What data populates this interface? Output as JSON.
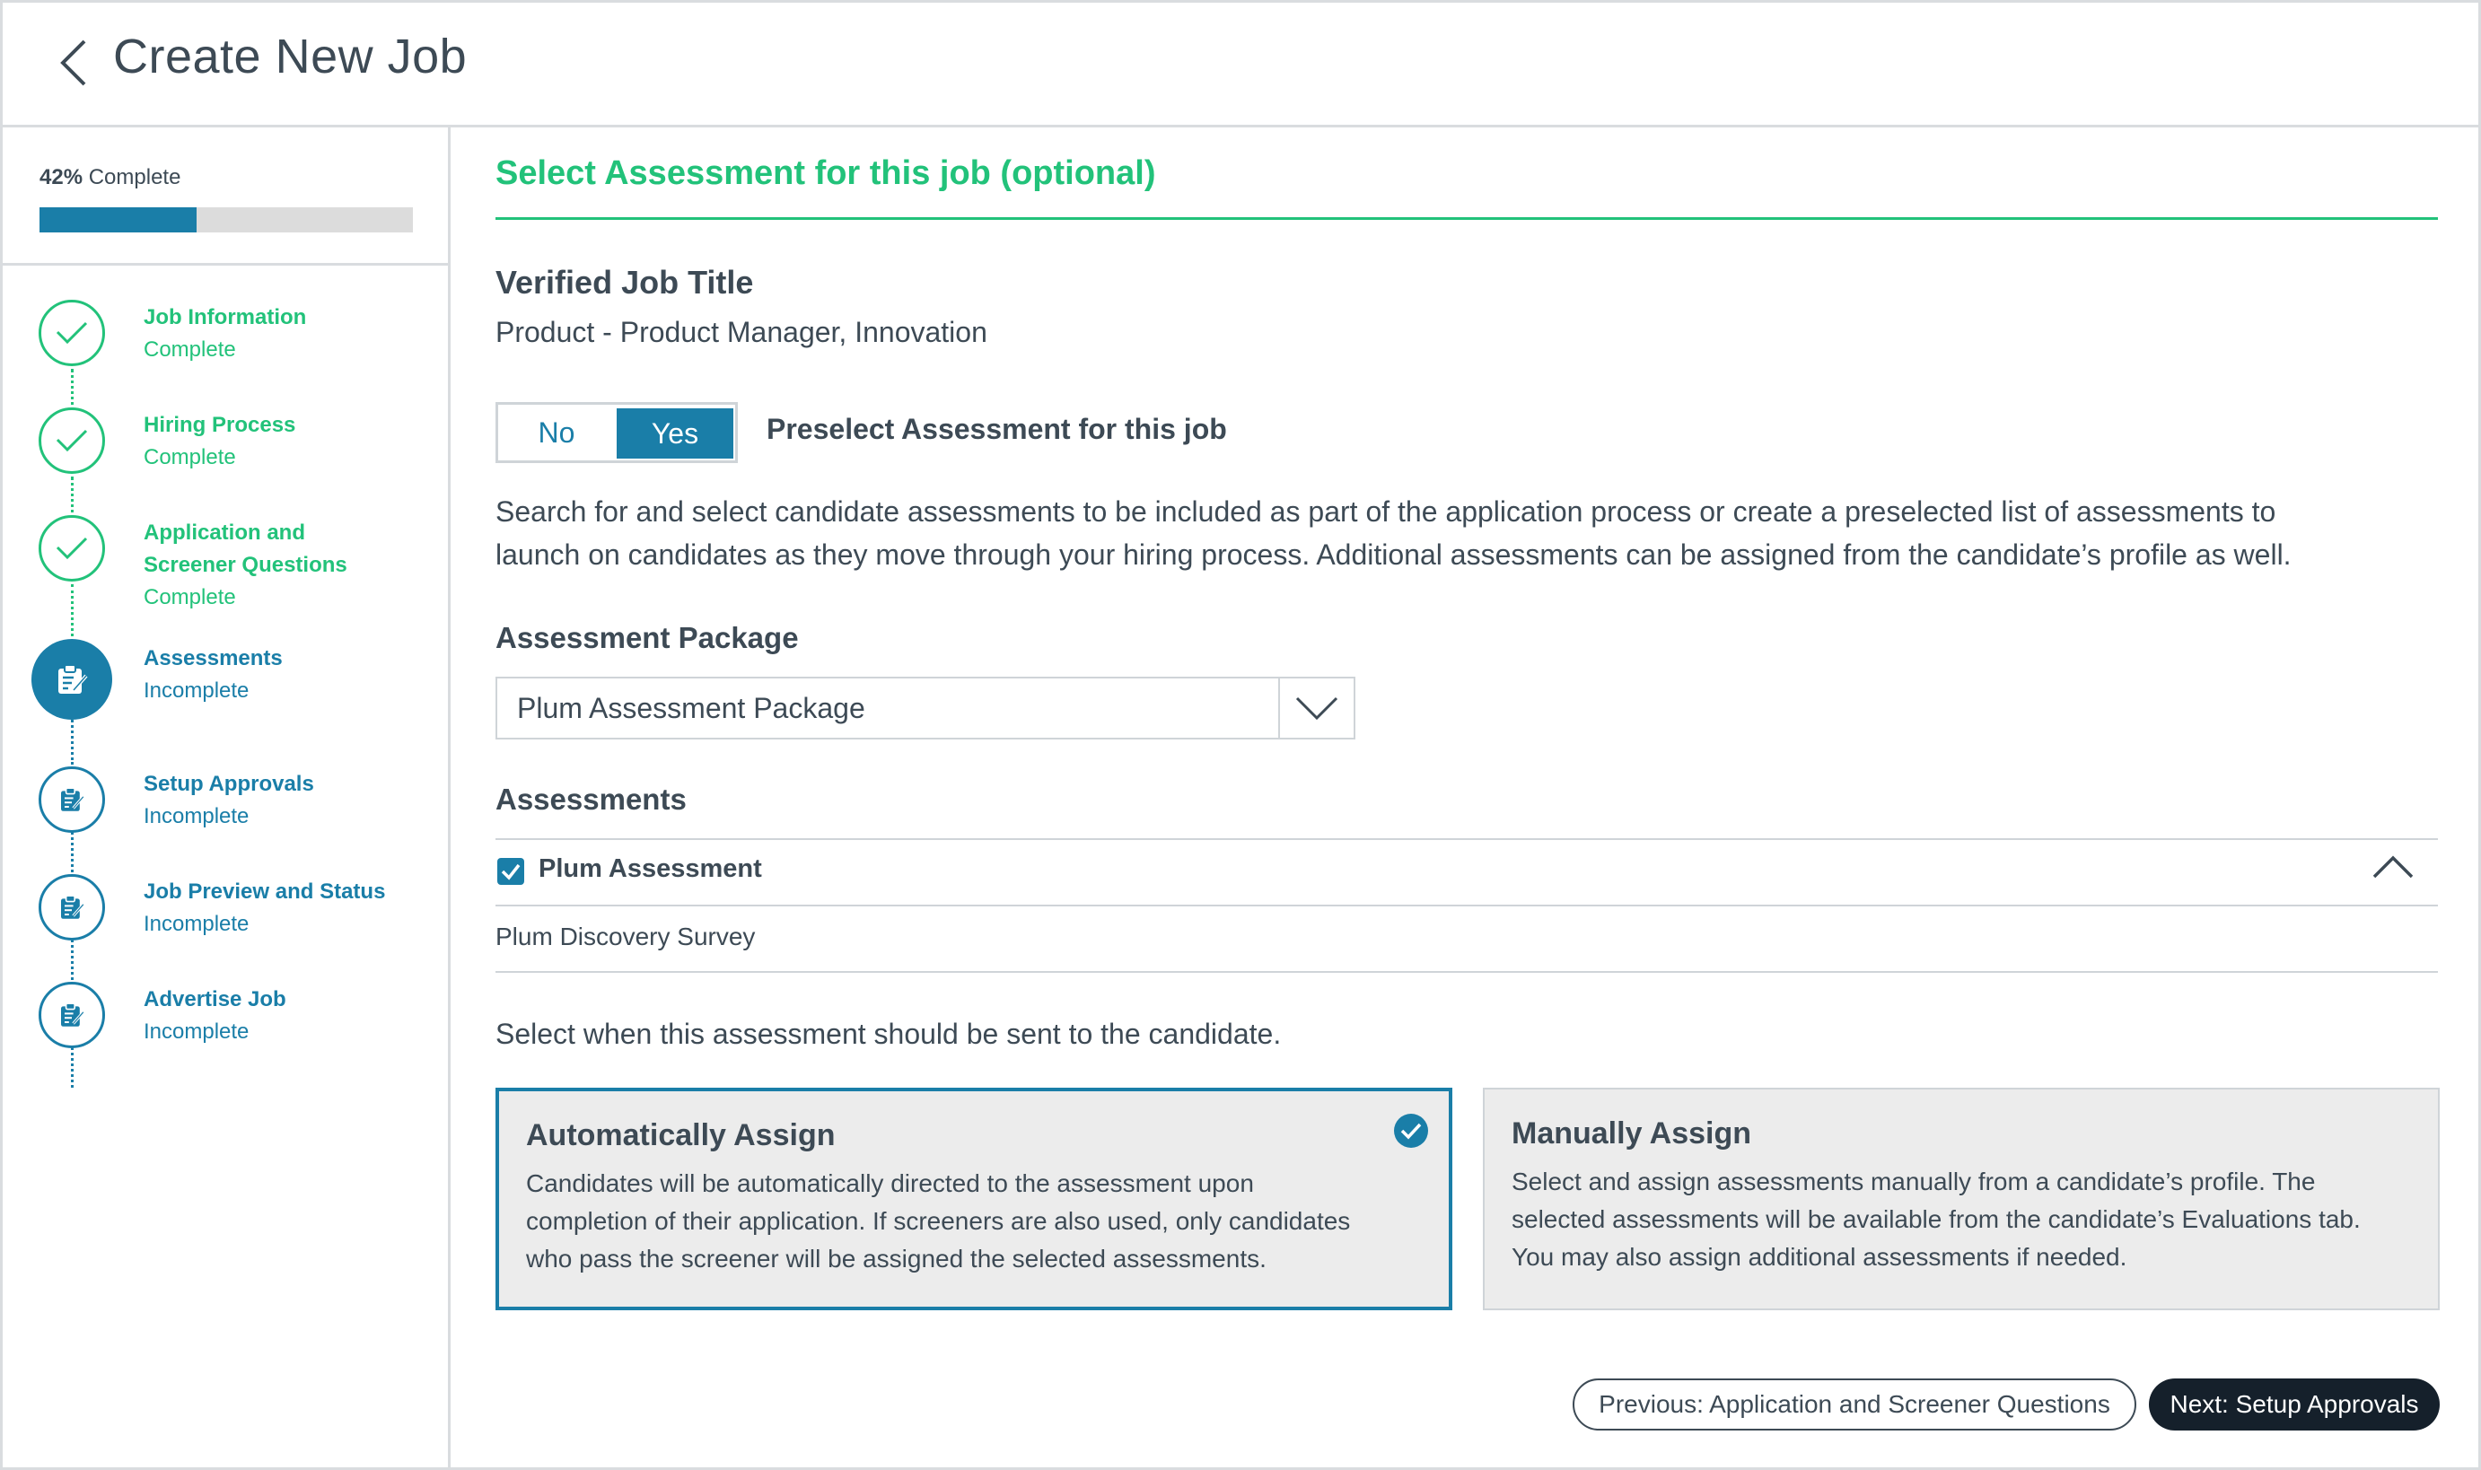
{
  "header": {
    "title": "Create New Job"
  },
  "progress": {
    "percent_label": "42%",
    "suffix": "Complete",
    "fraction": 0.42
  },
  "steps": [
    {
      "title": "Job Information",
      "status": "Complete",
      "state": "complete"
    },
    {
      "title": "Hiring Process",
      "status": "Complete",
      "state": "complete"
    },
    {
      "title_line1": "Application and",
      "title_line2": "Screener Questions",
      "status": "Complete",
      "state": "complete"
    },
    {
      "title": "Assessments",
      "status": "Incomplete",
      "state": "active"
    },
    {
      "title": "Setup Approvals",
      "status": "Incomplete",
      "state": "incomplete"
    },
    {
      "title": "Job Preview and Status",
      "status": "Incomplete",
      "state": "incomplete"
    },
    {
      "title": "Advertise Job",
      "status": "Incomplete",
      "state": "incomplete"
    }
  ],
  "main": {
    "heading": "Select Assessment for this job (optional)",
    "verified_label": "Verified Job Title",
    "verified_value": "Product - Product Manager, Innovation",
    "toggle": {
      "no": "No",
      "yes": "Yes",
      "selected": "Yes"
    },
    "preselect_label": "Preselect Assessment for this job",
    "description_line1": "Search for and select candidate assessments to be included as part of the application process or create a preselected list of assessments to",
    "description_line2": "launch on candidates as they move through your hiring process. Additional assessments can be assigned from the candidate’s profile as well.",
    "package_label": "Assessment Package",
    "package_value": "Plum Assessment Package",
    "assessments_label": "Assessments",
    "assessment_name": "Plum Assessment",
    "assessment_sub": "Plum Discovery Survey",
    "send_prompt": "Select when this assessment should be sent to the candidate.",
    "auto_card": {
      "title": "Automatically Assign",
      "line1": "Candidates will be automatically directed to the assessment upon",
      "line2": "completion of their application. If screeners are also used, only candidates",
      "line3": "who pass the screener will be assigned the selected assessments."
    },
    "manual_card": {
      "title": "Manually Assign",
      "line1": "Select and assign assessments manually from a candidate’s profile. The",
      "line2": "selected assessments will be available from the candidate’s Evaluations tab.",
      "line3": "You may also assign additional assessments if needed."
    },
    "prev_button": "Previous: Application and Screener Questions",
    "next_button": "Next: Setup Approvals"
  },
  "colors": {
    "green": "#22c27a",
    "blue": "#1a7ea8",
    "dark": "#15202b",
    "text": "#3d4a55"
  }
}
